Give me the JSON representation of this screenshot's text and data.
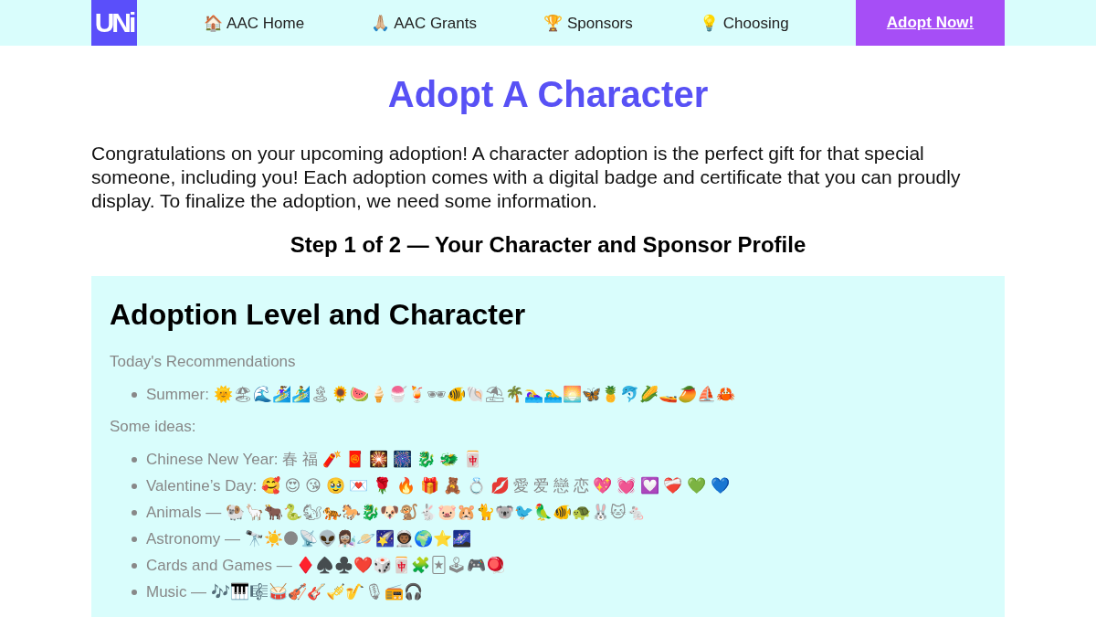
{
  "nav": {
    "logo": "UNi",
    "links": [
      "🏠 AAC Home",
      "🙏🏼 AAC Grants",
      "🏆 Sponsors",
      "💡 Choosing"
    ],
    "cta": "Adopt Now!"
  },
  "title": "Adopt A Character",
  "intro": "Congratulations on your upcoming adoption! A character adoption is the perfect gift for that special someone, including you! Each adoption comes with a digital badge and certificate that you can proudly display. To finalize the adoption, we need some information.",
  "step_heading": "Step 1 of 2 — Your Character and Sponsor Profile",
  "section": {
    "heading": "Adoption Level and Character",
    "groups": [
      {
        "label": "Today's Recommendations",
        "items": [
          "Summer: 🌞🏖🌊🏄‍♀️🏄‍♂️🏝🌻🍉🍦🍧🍹🕶🐠🐚⛱🌴🏊‍♀️🏊‍♂️🌅🦋🍍🐬🌽🚤🥭⛵🦀"
        ]
      },
      {
        "label": "Some ideas:",
        "items": [
          "Chinese New Year: 春 福 🧨 🧧 🎇 🎆 🐉 🐲 🀄",
          "Valentine’s Day: 🥰 😍 😘 🥹 💌 🌹 🔥 🎁 🧸 💍 💋 愛 爱 戀 恋 💖 💓 💟 ❤️‍🩹 💚 💙",
          "Animals — 🐏🦙🐂🐍🐿🐅🐎🐉🐶🐒🐇🐷🐹🐈🐨🐦🦜🐠🐢🐰🐱🐁",
          "Astronomy — 🔭☀️🌑📡👽👩🏽‍🔬🪐🌠👨🏾‍🚀🌍⭐🌌",
          "Cards and Games — ♦️♠️♣️❤️🎲🀄🧩🃏🕹🎮🪀",
          "Music — 🎶🎹🎼🥁🎻🎸🎺🎷🎙📻🎧"
        ]
      }
    ]
  }
}
